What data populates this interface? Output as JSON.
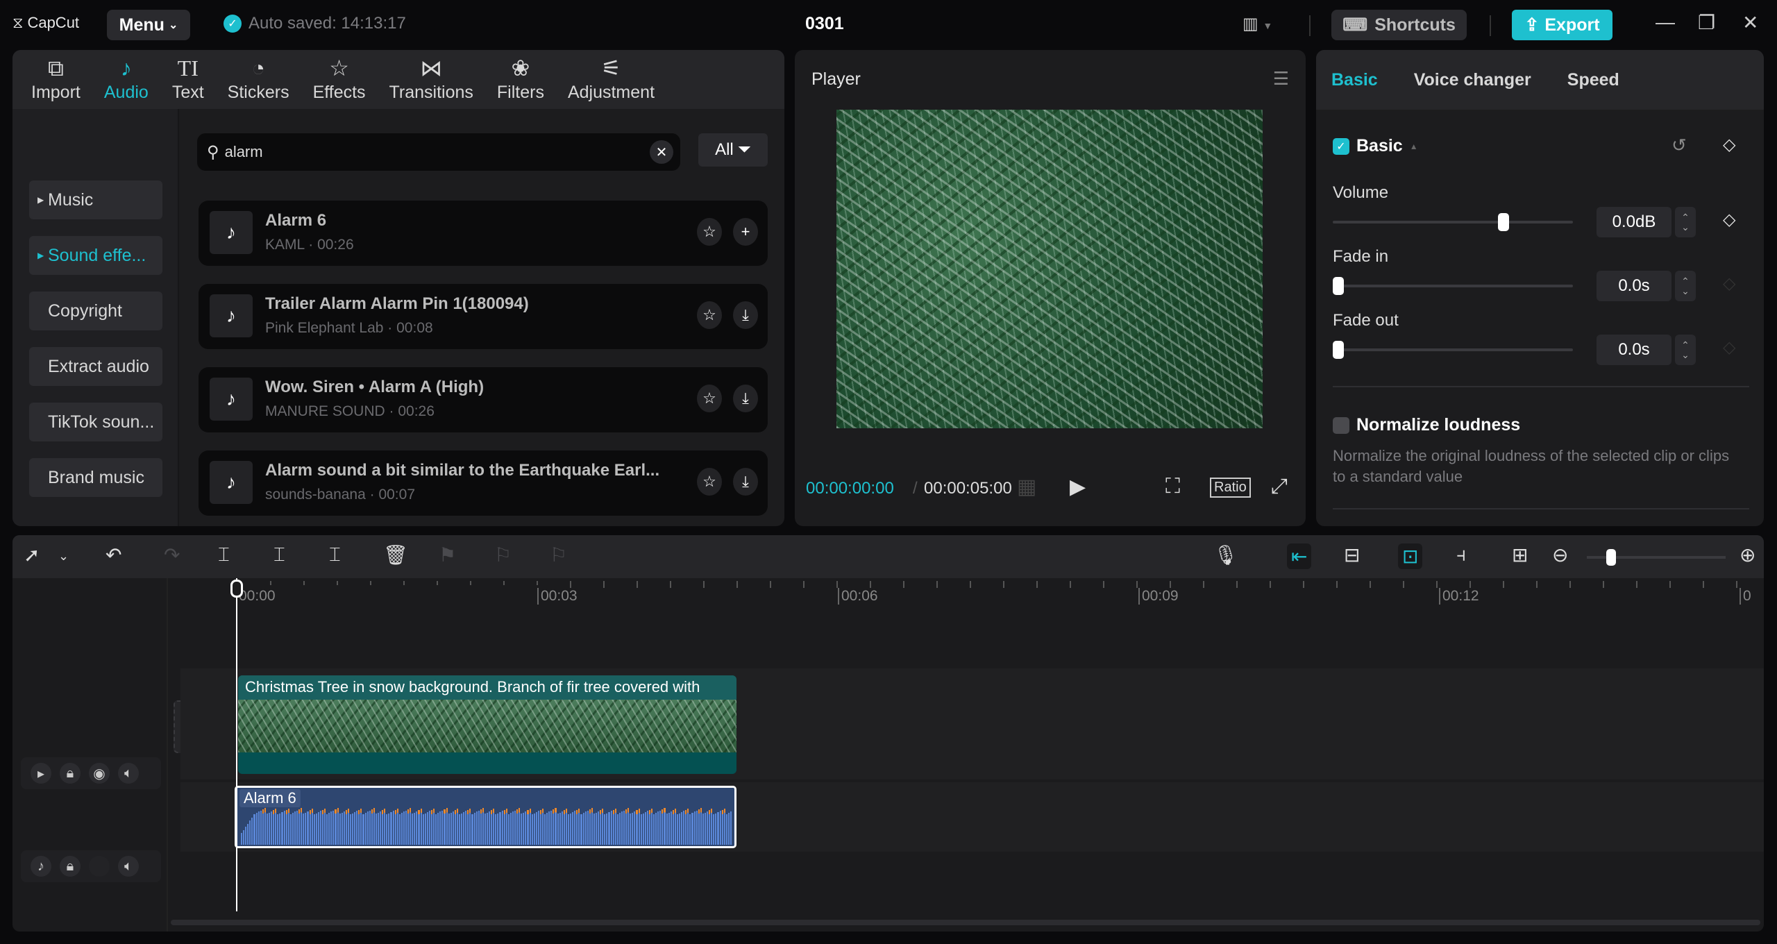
{
  "titlebar": {
    "app_name": "CapCut",
    "menu_label": "Menu",
    "autosave": "Auto saved: 14:13:17",
    "project_title": "0301",
    "shortcuts_label": "Shortcuts",
    "export_label": "Export"
  },
  "toolbar": {
    "tabs": [
      {
        "label": "Import",
        "icon": "import-icon"
      },
      {
        "label": "Audio",
        "icon": "audio-icon"
      },
      {
        "label": "Text",
        "icon": "text-icon"
      },
      {
        "label": "Stickers",
        "icon": "stickers-icon"
      },
      {
        "label": "Effects",
        "icon": "effects-icon"
      },
      {
        "label": "Transitions",
        "icon": "transitions-icon"
      },
      {
        "label": "Filters",
        "icon": "filters-icon"
      },
      {
        "label": "Adjustment",
        "icon": "adjustment-icon"
      }
    ],
    "active": "Audio"
  },
  "categories": [
    "Music",
    "Sound effe...",
    "Copyright",
    "Extract audio",
    "TikTok soun...",
    "Brand music"
  ],
  "search": {
    "value": "alarm",
    "filter_label": "All"
  },
  "results": [
    {
      "title": "Alarm 6",
      "subtitle": "KAML · 00:26",
      "action": "add"
    },
    {
      "title": "Trailer Alarm Alarm Pin 1(180094)",
      "subtitle": "Pink Elephant Lab · 00:08",
      "action": "download"
    },
    {
      "title": "Wow. Siren • Alarm A (High)",
      "subtitle": "MANURE SOUND · 00:26",
      "action": "download"
    },
    {
      "title": "Alarm sound a bit similar to the Earthquake Earl...",
      "subtitle": "sounds-banana · 00:07",
      "action": "download"
    }
  ],
  "player": {
    "title": "Player",
    "current_time": "00:00:00:00",
    "duration": "00:00:05:00",
    "ratio_label": "Ratio"
  },
  "inspector": {
    "tabs": [
      "Basic",
      "Voice changer",
      "Speed"
    ],
    "section": "Basic",
    "volume_label": "Volume",
    "volume_value": "0.0dB",
    "volume_fraction": 0.72,
    "fade_in_label": "Fade in",
    "fade_in_value": "0.0s",
    "fade_out_label": "Fade out",
    "fade_out_value": "0.0s",
    "normalize_label": "Normalize loudness",
    "normalize_desc": "Normalize the original loudness of the selected clip or clips to a standard value"
  },
  "timeline": {
    "ruler": [
      "00:00",
      "00:03",
      "00:06",
      "00:09",
      "00:12",
      "0"
    ],
    "video_clip": "Christmas Tree in snow background. Branch of fir tree covered with",
    "audio_clip": "Alarm 6",
    "zoom_fraction": 0.15
  },
  "colors": {
    "accent": "#1ec0cf",
    "video_clip": "#045152",
    "audio_clip": "#2e4670"
  }
}
